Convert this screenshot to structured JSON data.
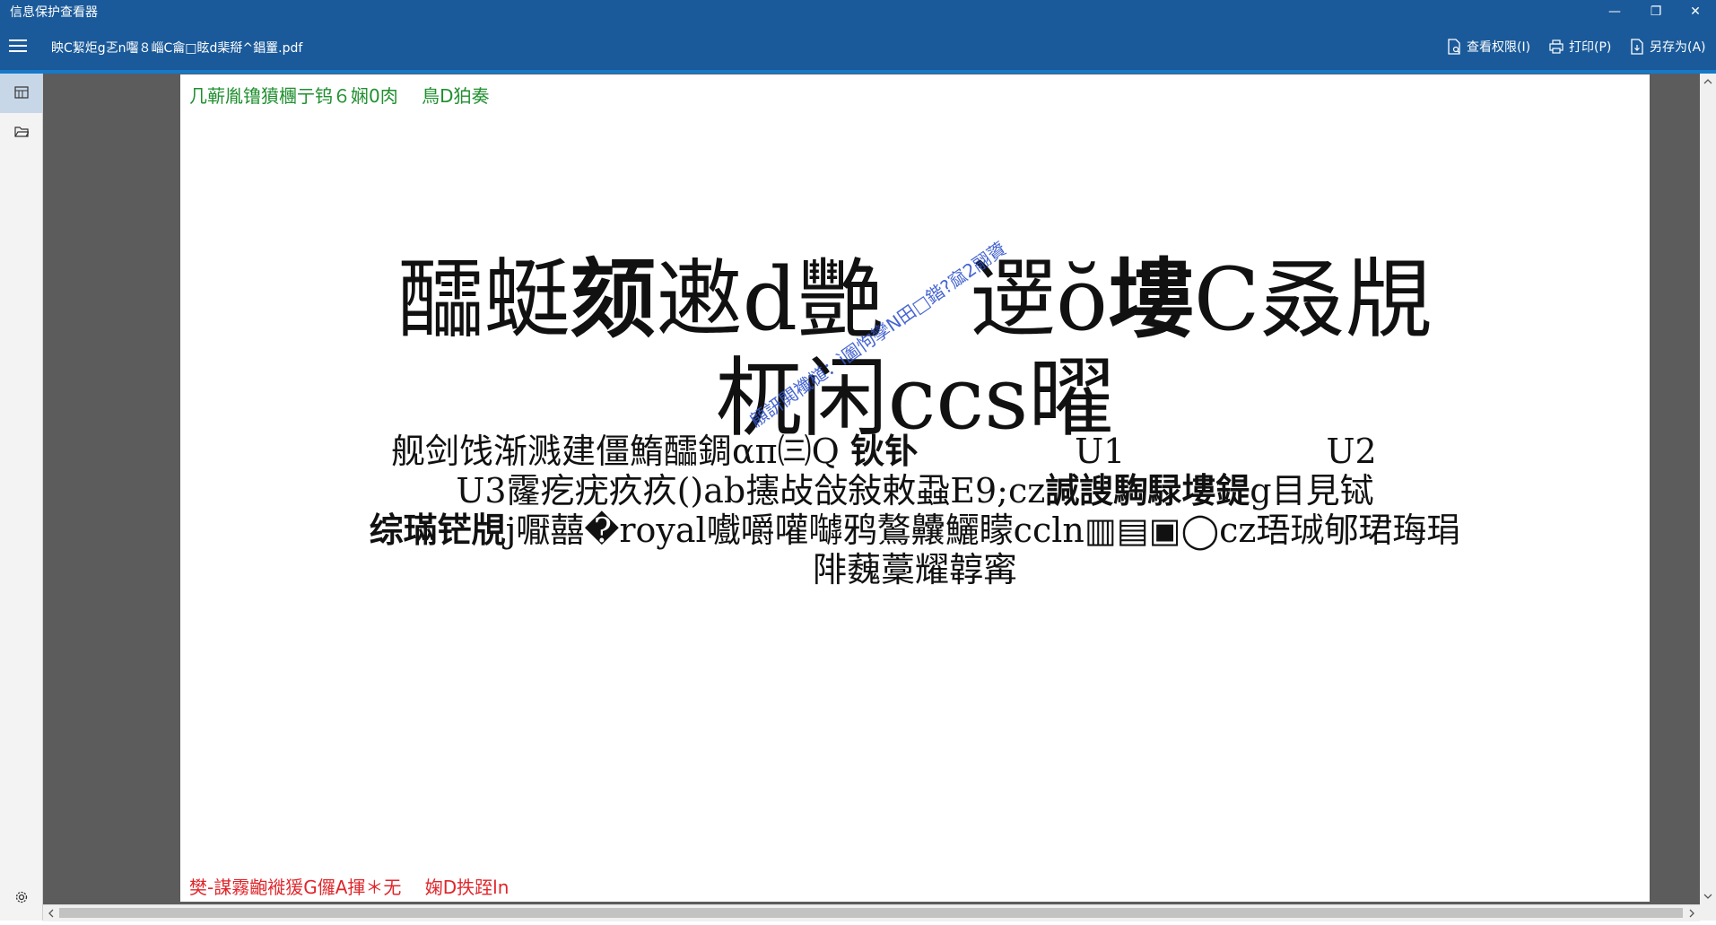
{
  "window": {
    "title": "信息保护查看器",
    "controls": {
      "minimize": "—",
      "restore": "❐",
      "close": "✕"
    }
  },
  "toolbar": {
    "menu_icon": "hamburger-icon",
    "filename": "眏C絜炬g乤n囓８崰C龠□眩d棐搿^錩罿.pdf",
    "view_permissions": "查看权限(I)",
    "print": "打印(P)",
    "save_as": "另存为(A)"
  },
  "sidebar": {
    "items": [
      {
        "name": "thumbnails",
        "icon": "pages-icon"
      },
      {
        "name": "open",
        "icon": "folder-icon"
      }
    ],
    "settings_icon": "gear-icon"
  },
  "document": {
    "header_text": "几蕲胤镥獖檲亍钨６娴0肉　 鳥D狛奏",
    "footer_text": "樊-謀霧齙褷猨G儸A揮＊无　 婅D抶跮ln",
    "title_line1_a": "醽蜓",
    "title_line1_b": "颏",
    "title_line1_c": "遫d艷　",
    "title_line1_d": "遻ŏ",
    "title_line1_e": "塿",
    "title_line1_f": "C叒覑",
    "title_line2": "杌闲ccs曜",
    "body_line1_a": "舰剑饯渐溅建僵鰖醽錭απ㈢Q",
    "body_line1_b": "钬钋",
    "body_line1_c": "U1",
    "body_line1_d": "U2",
    "body_line2_a": "U3霳疙疣疚疚()ab攇敁敆敍敕蝨E9;cz",
    "body_line2_b": "諴謏騊騄塿鍉",
    "body_line2_c": "g目見铽",
    "body_line3_a": "综璊铓覑",
    "body_line3_b": "j嚈囍�royal嚱嚼嚾嚹鸦鷔齉鱺矇ccln▥▤▣◯cz珸珹郇珺珻琄",
    "body_line4": "陫蘶藳耀韕寗",
    "watermark": "顅訮閧襳檤：ì圗怐孿N田□鍇?窳2翮薋"
  }
}
